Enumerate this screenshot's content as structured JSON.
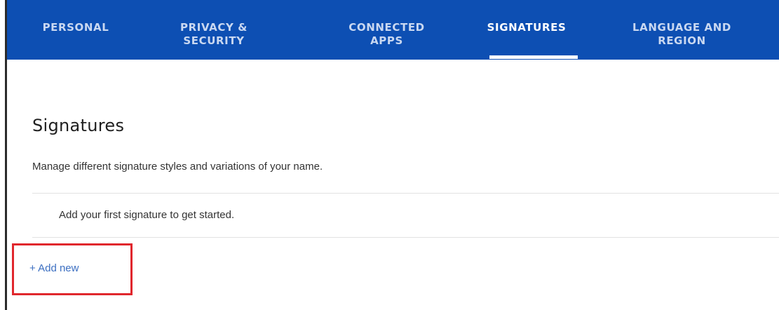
{
  "tabs": [
    {
      "line1": "PERSONAL",
      "line2": ""
    },
    {
      "line1": "PRIVACY &",
      "line2": "SECURITY"
    },
    {
      "line1": "CONNECTED",
      "line2": "APPS"
    },
    {
      "line1": "SIGNATURES",
      "line2": ""
    },
    {
      "line1": "LANGUAGE AND",
      "line2": "REGION"
    }
  ],
  "active_tab": "SIGNATURES",
  "page": {
    "title": "Signatures",
    "description": "Manage different signature styles and variations of your name.",
    "empty_message": "Add your first signature to get started.",
    "add_new_label": "+ Add new"
  },
  "colors": {
    "tabbar_bg": "#0d4fb3",
    "tab_inactive_text": "#c9d8f1",
    "tab_active_text": "#ffffff",
    "link": "#3c6fc1",
    "highlight_box": "#e0272d"
  }
}
